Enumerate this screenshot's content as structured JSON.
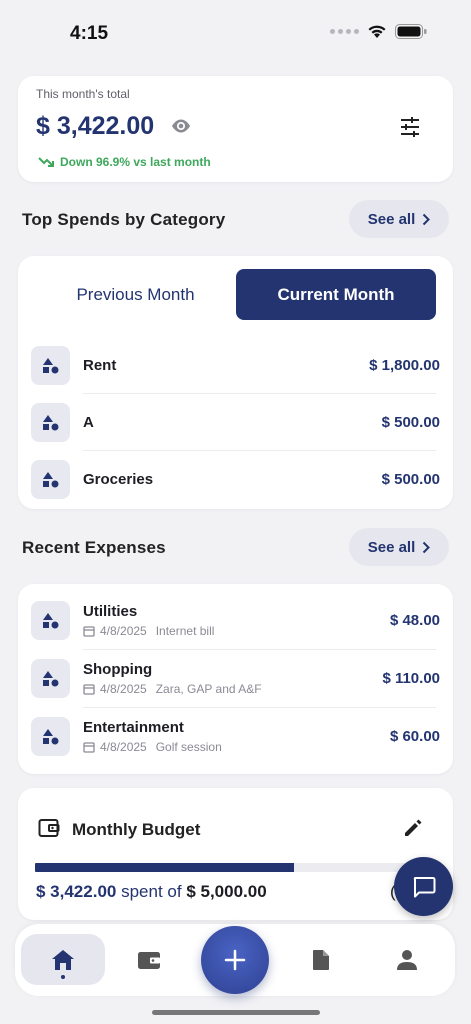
{
  "status_bar": {
    "time": "4:15"
  },
  "total": {
    "label": "This month's total",
    "amount": "$ 3,422.00",
    "trend": "Down 96.9% vs last month"
  },
  "top_spends": {
    "title": "Top Spends by Category",
    "see_all": "See all",
    "tabs": {
      "previous": "Previous Month",
      "current": "Current Month",
      "selected": "Current Month"
    },
    "items": [
      {
        "name": "Rent",
        "amount": "$ 1,800.00"
      },
      {
        "name": "A",
        "amount": "$ 500.00"
      },
      {
        "name": "Groceries",
        "amount": "$ 500.00"
      }
    ]
  },
  "recent": {
    "title": "Recent Expenses",
    "see_all": "See all",
    "items": [
      {
        "name": "Utilities",
        "date": "4/8/2025",
        "note": "Internet bill",
        "amount": "$ 48.00"
      },
      {
        "name": "Shopping",
        "date": "4/8/2025",
        "note": "Zara, GAP and A&F",
        "amount": "$ 110.00"
      },
      {
        "name": "Entertainment",
        "date": "4/8/2025",
        "note": "Golf session",
        "amount": "$ 60.00"
      }
    ]
  },
  "budget": {
    "title": "Monthly Budget",
    "spent": "$ 3,422.00",
    "spent_word": "spent of",
    "total": "$ 5,000.00",
    "paren": "(",
    "progress_fraction": 0.684
  },
  "colors": {
    "primary": "#233470",
    "positive": "#3ea85b",
    "background": "#f2f2f5"
  },
  "icons": {
    "status": [
      "wifi-icon",
      "battery-icon"
    ],
    "tabs": [
      "home-icon",
      "wallet-icon",
      "plus-icon",
      "document-icon",
      "person-icon"
    ]
  }
}
